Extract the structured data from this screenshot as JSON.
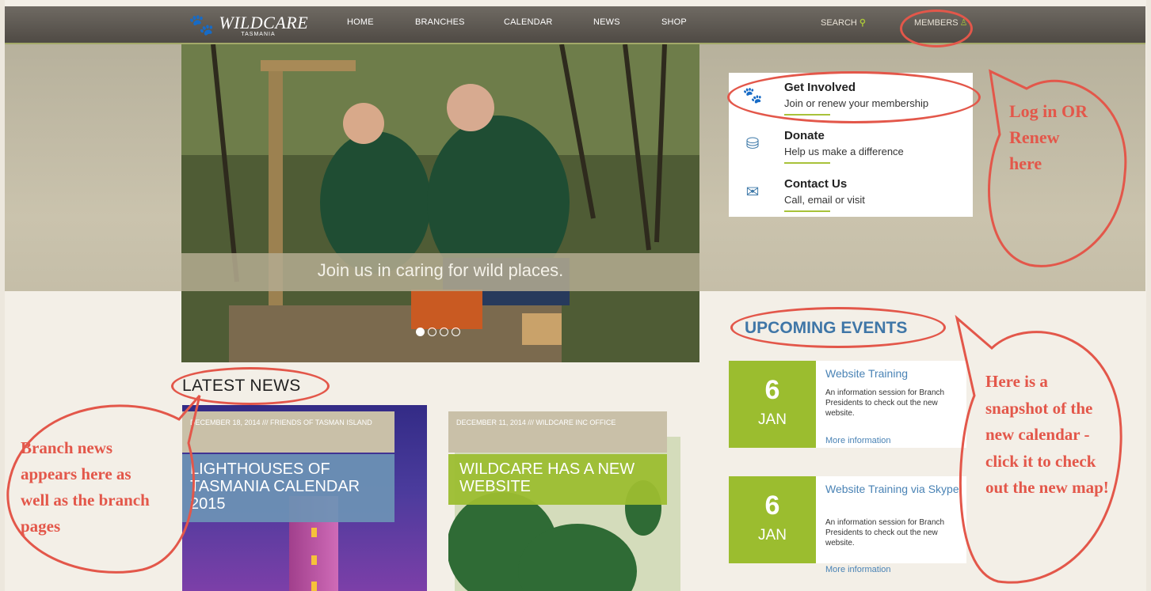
{
  "brand": {
    "title": "WILDCARE",
    "subtitle": "TASMANIA"
  },
  "nav": {
    "items": [
      "HOME",
      "BRANCHES",
      "CALENDAR",
      "NEWS",
      "SHOP"
    ],
    "search_label": "SEARCH",
    "members_label": "MEMBERS"
  },
  "hero": {
    "caption": "Join us in caring for wild places."
  },
  "actions": [
    {
      "title": "Get Involved",
      "desc": "Join or renew your membership"
    },
    {
      "title": "Donate",
      "desc": "Help us make a difference"
    },
    {
      "title": "Contact Us",
      "desc": "Call, email or visit"
    }
  ],
  "events": {
    "heading": "UPCOMING EVENTS",
    "items": [
      {
        "day": "6",
        "month": "JAN",
        "title": "Website Training",
        "desc": "An information session for Branch Presidents to check out the new website.",
        "more": "More information"
      },
      {
        "day": "6",
        "month": "JAN",
        "title": "Website Training via Skype",
        "desc": "An information session for Branch Presidents to check out the new website.",
        "more": "More information"
      }
    ]
  },
  "news": {
    "heading": "LATEST NEWS",
    "cards": [
      {
        "meta": "DECEMBER 18, 2014 /// FRIENDS OF TASMAN ISLAND",
        "title": "LIGHTHOUSES OF TASMANIA CALENDAR 2015"
      },
      {
        "meta": "DECEMBER 11, 2014 /// WILDCARE INC OFFICE",
        "title": "WILDCARE HAS A NEW WEBSITE"
      }
    ]
  },
  "annotations": {
    "login": "Log in OR Renew here",
    "branch": "Branch news appears here as well as the branch pages",
    "calendar": "Here is a snapshot of the new calendar - click it to check out the new map!"
  },
  "colors": {
    "accent_green": "#9bbd2f",
    "link_blue": "#4a83b5",
    "annotation_red": "#e3574a",
    "nav_bg": "#5b5650"
  }
}
